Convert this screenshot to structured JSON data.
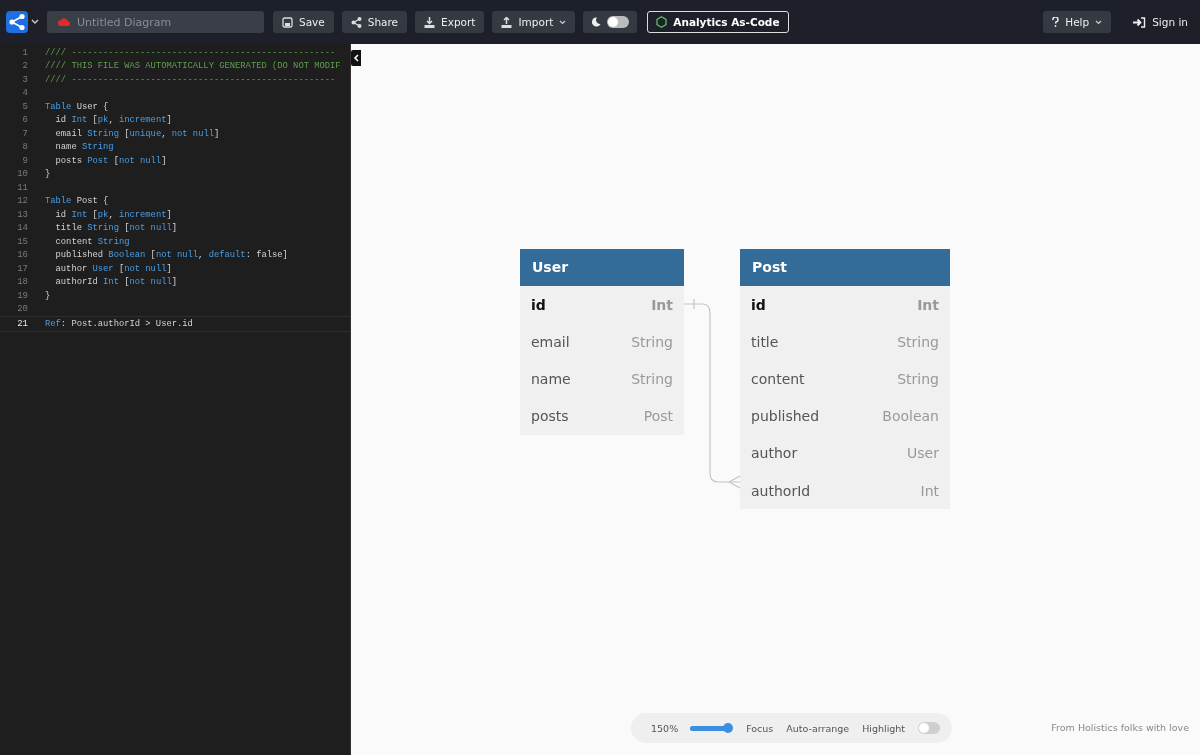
{
  "toolbar": {
    "title_field": {
      "placeholder": "Untitled Diagram"
    },
    "buttons": [
      {
        "label": "Save",
        "dropdown": false
      },
      {
        "label": "Share",
        "dropdown": false
      },
      {
        "label": "Export",
        "dropdown": false
      },
      {
        "label": "Import",
        "dropdown": true
      }
    ],
    "theme_toggle": {
      "on": false
    },
    "analytics_button": "Analytics As-Code",
    "help": "Help",
    "sign_in": "Sign in"
  },
  "editor": {
    "lines": [
      {
        "n": "1",
        "current": false,
        "tokens": [
          {
            "kind": "comment",
            "t": "//// --------------------------------------------------"
          }
        ]
      },
      {
        "n": "2",
        "current": false,
        "tokens": [
          {
            "kind": "comment",
            "t": "//// THIS FILE WAS AUTOMATICALLY GENERATED (DO NOT MODIF"
          }
        ]
      },
      {
        "n": "3",
        "current": false,
        "tokens": [
          {
            "kind": "comment",
            "t": "//// --------------------------------------------------"
          }
        ]
      },
      {
        "n": "4",
        "current": false
      },
      {
        "n": "5",
        "current": false,
        "tokens": [
          {
            "kind": "kw",
            "t": "Table"
          },
          {
            "kind": "plain",
            "t": " User {"
          }
        ]
      },
      {
        "n": "6",
        "current": false,
        "tokens": [
          {
            "kind": "plain",
            "t": "  id "
          },
          {
            "kind": "kw",
            "t": "Int"
          },
          {
            "kind": "plain",
            "t": " ["
          },
          {
            "kind": "kw",
            "t": "pk"
          },
          {
            "kind": "plain",
            "t": ", "
          },
          {
            "kind": "kw",
            "t": "increment"
          },
          {
            "kind": "plain",
            "t": "]"
          }
        ]
      },
      {
        "n": "7",
        "current": false,
        "tokens": [
          {
            "kind": "plain",
            "t": "  email "
          },
          {
            "kind": "kw",
            "t": "String"
          },
          {
            "kind": "plain",
            "t": " ["
          },
          {
            "kind": "kw",
            "t": "unique"
          },
          {
            "kind": "plain",
            "t": ", "
          },
          {
            "kind": "kw",
            "t": "not null"
          },
          {
            "kind": "plain",
            "t": "]"
          }
        ]
      },
      {
        "n": "8",
        "current": false,
        "tokens": [
          {
            "kind": "plain",
            "t": "  name "
          },
          {
            "kind": "kw",
            "t": "String"
          }
        ]
      },
      {
        "n": "9",
        "current": false,
        "tokens": [
          {
            "kind": "plain",
            "t": "  posts "
          },
          {
            "kind": "kw",
            "t": "Post"
          },
          {
            "kind": "plain",
            "t": " ["
          },
          {
            "kind": "kw",
            "t": "not null"
          },
          {
            "kind": "plain",
            "t": "]"
          }
        ]
      },
      {
        "n": "10",
        "current": false,
        "tokens": [
          {
            "kind": "plain",
            "t": "}"
          }
        ]
      },
      {
        "n": "11",
        "current": false
      },
      {
        "n": "12",
        "current": false,
        "tokens": [
          {
            "kind": "kw",
            "t": "Table"
          },
          {
            "kind": "plain",
            "t": " Post {"
          }
        ]
      },
      {
        "n": "13",
        "current": false,
        "tokens": [
          {
            "kind": "plain",
            "t": "  id "
          },
          {
            "kind": "kw",
            "t": "Int"
          },
          {
            "kind": "plain",
            "t": " ["
          },
          {
            "kind": "kw",
            "t": "pk"
          },
          {
            "kind": "plain",
            "t": ", "
          },
          {
            "kind": "kw",
            "t": "increment"
          },
          {
            "kind": "plain",
            "t": "]"
          }
        ]
      },
      {
        "n": "14",
        "current": false,
        "tokens": [
          {
            "kind": "plain",
            "t": "  title "
          },
          {
            "kind": "kw",
            "t": "String"
          },
          {
            "kind": "plain",
            "t": " ["
          },
          {
            "kind": "kw",
            "t": "not null"
          },
          {
            "kind": "plain",
            "t": "]"
          }
        ]
      },
      {
        "n": "15",
        "current": false,
        "tokens": [
          {
            "kind": "plain",
            "t": "  content "
          },
          {
            "kind": "kw",
            "t": "String"
          }
        ]
      },
      {
        "n": "16",
        "current": false,
        "tokens": [
          {
            "kind": "plain",
            "t": "  published "
          },
          {
            "kind": "kw",
            "t": "Boolean"
          },
          {
            "kind": "plain",
            "t": " ["
          },
          {
            "kind": "kw",
            "t": "not null"
          },
          {
            "kind": "plain",
            "t": ", "
          },
          {
            "kind": "kw",
            "t": "default"
          },
          {
            "kind": "plain",
            "t": ": false]"
          }
        ]
      },
      {
        "n": "17",
        "current": false,
        "tokens": [
          {
            "kind": "plain",
            "t": "  author "
          },
          {
            "kind": "kw",
            "t": "User"
          },
          {
            "kind": "plain",
            "t": " ["
          },
          {
            "kind": "kw",
            "t": "not null"
          },
          {
            "kind": "plain",
            "t": "]"
          }
        ]
      },
      {
        "n": "18",
        "current": false,
        "tokens": [
          {
            "kind": "plain",
            "t": "  authorId "
          },
          {
            "kind": "kw",
            "t": "Int"
          },
          {
            "kind": "plain",
            "t": " ["
          },
          {
            "kind": "kw",
            "t": "not null"
          },
          {
            "kind": "plain",
            "t": "]"
          }
        ]
      },
      {
        "n": "19",
        "current": false,
        "tokens": [
          {
            "kind": "plain",
            "t": "}"
          }
        ]
      },
      {
        "n": "20",
        "current": false
      },
      {
        "n": "21",
        "current": true,
        "tokens": [
          {
            "kind": "kw",
            "t": "Ref"
          },
          {
            "kind": "plain",
            "t": ": Post.authorId > User.id"
          }
        ]
      }
    ]
  },
  "diagram": {
    "tables": [
      {
        "name": "User",
        "fields": [
          {
            "name": "id",
            "type": "Int",
            "pk": true
          },
          {
            "name": "email",
            "type": "String",
            "pk": false
          },
          {
            "name": "name",
            "type": "String",
            "pk": false
          },
          {
            "name": "posts",
            "type": "Post",
            "pk": false
          }
        ]
      },
      {
        "name": "Post",
        "fields": [
          {
            "name": "id",
            "type": "Int",
            "pk": true
          },
          {
            "name": "title",
            "type": "String",
            "pk": false
          },
          {
            "name": "content",
            "type": "String",
            "pk": false
          },
          {
            "name": "published",
            "type": "Boolean",
            "pk": false
          },
          {
            "name": "author",
            "type": "User",
            "pk": false
          },
          {
            "name": "authorId",
            "type": "Int",
            "pk": false
          }
        ]
      }
    ]
  },
  "bottom_bar": {
    "zoom": "150%",
    "zoom_slider": {
      "level": 1
    },
    "focus": "Focus",
    "auto_arrange": "Auto-arrange",
    "highlight": {
      "label": "Highlight",
      "on": false
    }
  },
  "footer": "From Holistics folks with love"
}
